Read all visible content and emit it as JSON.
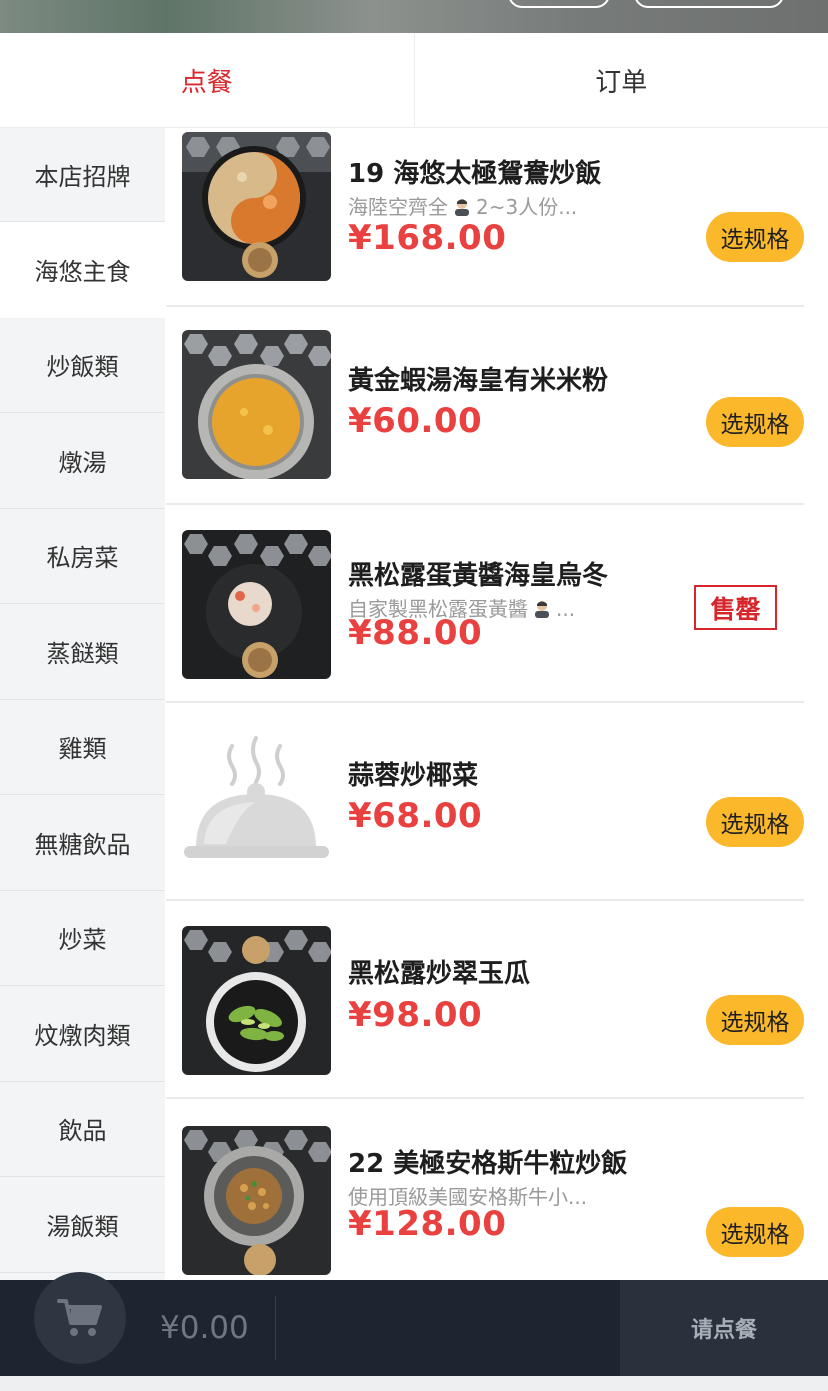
{
  "tabs": [
    {
      "label": "点餐",
      "active": true
    },
    {
      "label": "订单",
      "active": false
    }
  ],
  "sidebar": {
    "items": [
      {
        "label": "本店招牌"
      },
      {
        "label": "海悠主食"
      },
      {
        "label": "炒飯類"
      },
      {
        "label": "燉湯"
      },
      {
        "label": "私房菜"
      },
      {
        "label": "蒸餸類"
      },
      {
        "label": "雞類"
      },
      {
        "label": "無糖飲品"
      },
      {
        "label": "炒菜"
      },
      {
        "label": "炆燉肉類"
      },
      {
        "label": "飲品"
      },
      {
        "label": "湯飯類"
      }
    ],
    "active_index": 1
  },
  "menu": {
    "dishes": [
      {
        "name": "19 海悠太極鴛鴦炒飯",
        "desc_prefix": "海陸空齊全",
        "desc_suffix": "2~3人份...",
        "price": "¥168.00",
        "button": "选规格",
        "image": "yin-yang-fried-rice"
      },
      {
        "name": "黃金蝦湯海皇有米米粉",
        "desc_prefix": "",
        "desc_suffix": "",
        "price": "¥60.00",
        "button": "选规格",
        "image": "golden-shrimp-soup"
      },
      {
        "name": "黑松露蛋黃醬海皇烏冬",
        "desc_prefix": "自家製黑松露蛋黃醬",
        "desc_suffix": "...",
        "price": "¥88.00",
        "sold_out": "售罄",
        "image": "truffle-udon"
      },
      {
        "name": "蒜蓉炒椰菜",
        "desc_prefix": "",
        "desc_suffix": "",
        "price": "¥68.00",
        "button": "选规格",
        "image": "placeholder-cloche"
      },
      {
        "name": "黑松露炒翠玉瓜",
        "desc_prefix": "",
        "desc_suffix": "",
        "price": "¥98.00",
        "button": "选规格",
        "image": "stir-fried-zucchini"
      },
      {
        "name": "22 美極安格斯牛粒炒飯",
        "desc_prefix": "使用頂級美國安格斯牛小...",
        "desc_suffix": "",
        "price": "¥128.00",
        "button": "选规格",
        "image": "angus-beef-fried-rice"
      }
    ]
  },
  "cart": {
    "total": "¥0.00",
    "submit_label": "请点餐",
    "icon": "cart-icon"
  },
  "colors": {
    "accent_red": "#d9292d",
    "price_red": "#e8413f",
    "button_yellow": "#fbb82b",
    "bar_dark": "#1d2530"
  }
}
